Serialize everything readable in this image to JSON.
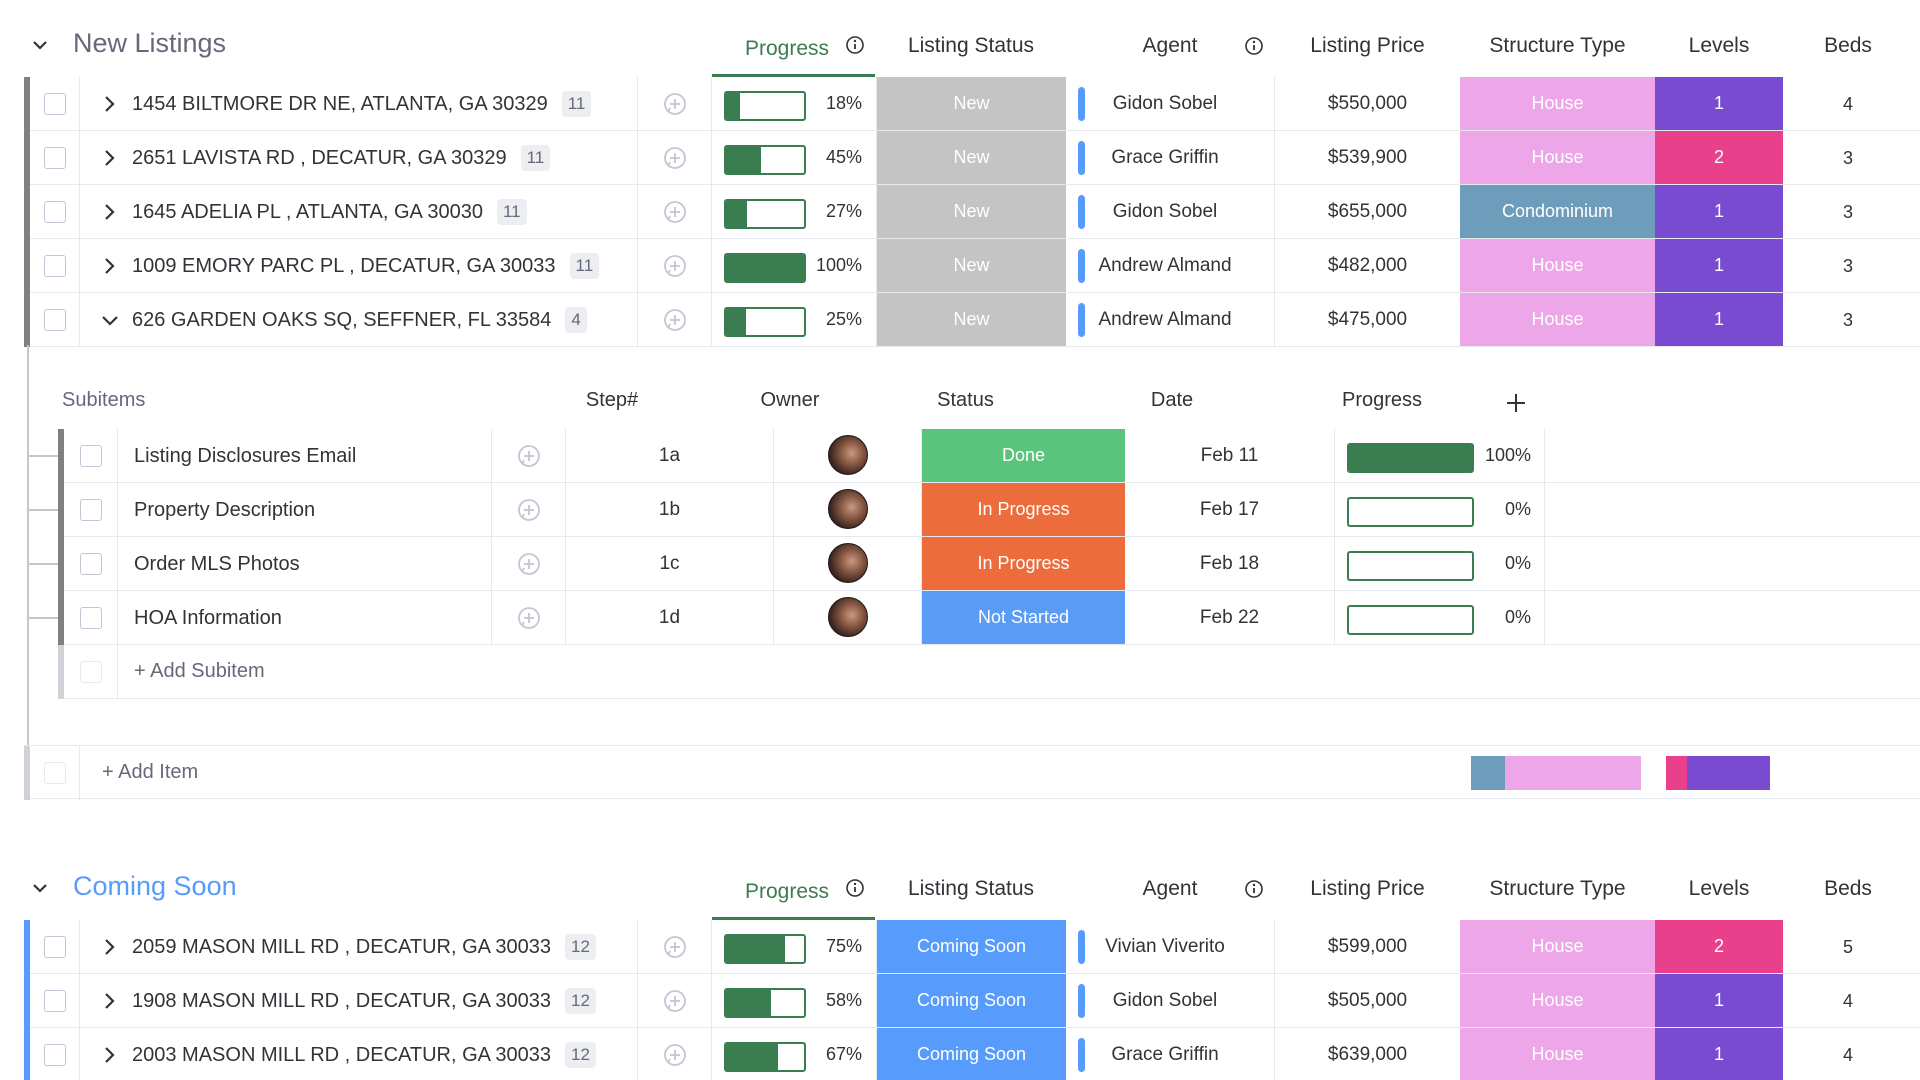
{
  "colors": {
    "progress_green": "#3a7d50",
    "status_new": "#c4c4c4",
    "status_coming_soon": "#579bfc",
    "status_done": "#5ac47d",
    "status_in_progress": "#ec6c3c",
    "status_not_started": "#5a9cf5",
    "house": "#eda7e8",
    "condominium": "#6e9dbb",
    "level_1": "#784bd1",
    "level_2": "#e8408b",
    "group_new_stripe": "#808080",
    "group_coming_stripe": "#579bfc",
    "coming_soon_title": "#579bfc",
    "new_listings_title": "#676879"
  },
  "columns": {
    "progress": "Progress",
    "listing_status": "Listing Status",
    "agent": "Agent",
    "listing_price": "Listing Price",
    "structure_type": "Structure Type",
    "levels": "Levels",
    "beds": "Beds"
  },
  "groups": [
    {
      "title": "New Listings",
      "items": [
        {
          "name": "1454 BILTMORE DR NE, ATLANTA, GA 30329",
          "count": "11",
          "progress": 18,
          "progress_label": "18%",
          "status": "New",
          "agent": "Gidon Sobel",
          "price": "$550,000",
          "structure": "House",
          "levels": "1",
          "beds": "4",
          "expanded": false
        },
        {
          "name": "2651 LAVISTA RD , DECATUR, GA 30329",
          "count": "11",
          "progress": 45,
          "progress_label": "45%",
          "status": "New",
          "agent": "Grace Griffin",
          "price": "$539,900",
          "structure": "House",
          "levels": "2",
          "beds": "3",
          "expanded": false
        },
        {
          "name": "1645 ADELIA PL , ATLANTA, GA 30030",
          "count": "11",
          "progress": 27,
          "progress_label": "27%",
          "status": "New",
          "agent": "Gidon Sobel",
          "price": "$655,000",
          "structure": "Condominium",
          "levels": "1",
          "beds": "3",
          "expanded": false
        },
        {
          "name": "1009 EMORY PARC PL , DECATUR, GA 30033",
          "count": "11",
          "progress": 100,
          "progress_label": "100%",
          "status": "New",
          "agent": "Andrew Almand",
          "price": "$482,000",
          "structure": "House",
          "levels": "1",
          "beds": "3",
          "expanded": false
        },
        {
          "name": "626 GARDEN OAKS SQ, SEFFNER, FL 33584",
          "count": "4",
          "progress": 25,
          "progress_label": "25%",
          "status": "New",
          "agent": "Andrew Almand",
          "price": "$475,000",
          "structure": "House",
          "levels": "1",
          "beds": "3",
          "expanded": true
        }
      ],
      "add_item": "+ Add Item"
    },
    {
      "title": "Coming Soon",
      "items": [
        {
          "name": "2059 MASON MILL RD , DECATUR, GA 30033",
          "count": "12",
          "progress": 75,
          "progress_label": "75%",
          "status": "Coming Soon",
          "agent": "Vivian Viverito",
          "price": "$599,000",
          "structure": "House",
          "levels": "2",
          "beds": "5"
        },
        {
          "name": "1908 MASON MILL RD , DECATUR, GA 30033",
          "count": "12",
          "progress": 58,
          "progress_label": "58%",
          "status": "Coming Soon",
          "agent": "Gidon Sobel",
          "price": "$505,000",
          "structure": "House",
          "levels": "1",
          "beds": "4"
        },
        {
          "name": "2003 MASON MILL RD , DECATUR, GA 30033",
          "count": "12",
          "progress": 67,
          "progress_label": "67%",
          "status": "Coming Soon",
          "agent": "Grace Griffin",
          "price": "$639,000",
          "structure": "House",
          "levels": "1",
          "beds": "4"
        }
      ]
    }
  ],
  "subitems": {
    "columns": {
      "subitems": "Subitems",
      "step": "Step#",
      "owner": "Owner",
      "status": "Status",
      "date": "Date",
      "progress": "Progress"
    },
    "rows": [
      {
        "name": "Listing Disclosures Email",
        "step": "1a",
        "status": "Done",
        "date": "Feb 11",
        "progress": 100,
        "progress_label": "100%"
      },
      {
        "name": "Property Description",
        "step": "1b",
        "status": "In Progress",
        "date": "Feb 17",
        "progress": 0,
        "progress_label": "0%"
      },
      {
        "name": "Order MLS Photos",
        "step": "1c",
        "status": "In Progress",
        "date": "Feb 18",
        "progress": 0,
        "progress_label": "0%"
      },
      {
        "name": "HOA Information",
        "step": "1d",
        "status": "Not Started",
        "date": "Feb 22",
        "progress": 0,
        "progress_label": "0%"
      }
    ],
    "add_subitem": "+ Add Subitem",
    "add_column_icon": "plus-icon"
  },
  "summary": {
    "structure_fraction": {
      "Condominium": 0.2,
      "House": 0.8
    },
    "levels_fraction": {
      "2": 0.2,
      "1": 0.8
    }
  }
}
